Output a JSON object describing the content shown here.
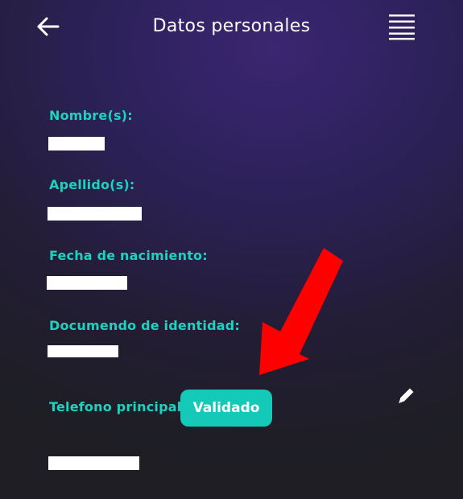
{
  "header": {
    "title": "Datos personales",
    "back_icon": "arrow-left-icon",
    "menu_icon": "hamburger-menu-icon"
  },
  "fields": {
    "nombre_label": "Nombre(s):",
    "apellido_label": "Apellido(s):",
    "fecha_label": "Fecha de nacimiento:",
    "documento_label": "Documendo de identidad:",
    "telefono_label": "Telefono principal:"
  },
  "telefono": {
    "status_badge": "Validado",
    "edit_icon": "pencil-icon"
  },
  "annotation": {
    "arrow_icon": "red-arrow-icon",
    "arrow_color": "#ff0000"
  },
  "colors": {
    "accent": "#1fd2c0",
    "badge": "#14c9b7",
    "redaction": "#ffffff"
  }
}
